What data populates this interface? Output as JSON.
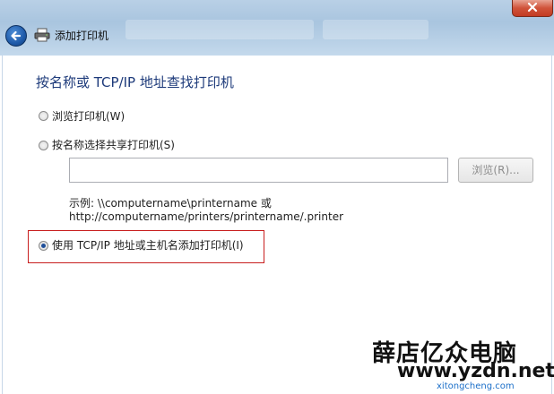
{
  "window": {
    "title": "添加打印机"
  },
  "main": {
    "heading": "按名称或 TCP/IP 地址查找打印机",
    "options": [
      {
        "label": "浏览打印机(W)",
        "checked": false
      },
      {
        "label": "按名称选择共享打印机(S)",
        "checked": false
      },
      {
        "label": "使用 TCP/IP 地址或主机名添加打印机(I)",
        "checked": true
      }
    ],
    "share_input": {
      "value": ""
    },
    "browse_label": "浏览(R)...",
    "example_line1": "示例: \\\\computername\\printername 或",
    "example_line2": "http://computername/printers/printername/.printer"
  },
  "watermark": {
    "line1": "薛店亿众电脑",
    "line2": "www.yzdn.net",
    "line3": "xitongcheng.com"
  },
  "icons": {
    "back": "back-arrow-icon",
    "printer": "printer-icon",
    "close": "close-icon",
    "radio": "radio-button-icon"
  },
  "colors": {
    "heading": "#1d3a7a",
    "highlight": "#c81e1e",
    "titlebar": "#a9c5df"
  }
}
